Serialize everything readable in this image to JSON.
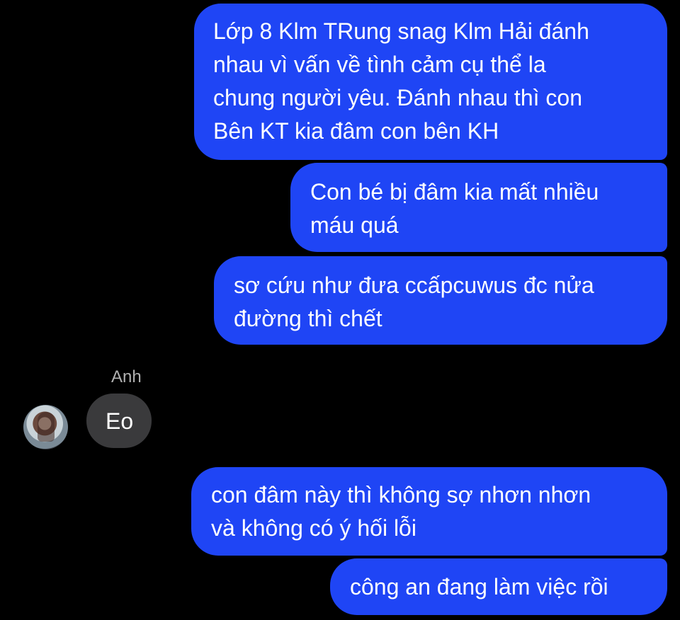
{
  "conversation": {
    "messages": [
      {
        "direction": "outgoing",
        "text": "Lớp 8 Klm TRung snag Klm Hải đánh\nnhau vì vấn về tình cảm cụ thể la\nchung người yêu. Đánh nhau thì con\nBên KT kia đâm con bên KH"
      },
      {
        "direction": "outgoing",
        "text": "Con bé bị đâm kia mất nhiều\nmáu quá"
      },
      {
        "direction": "outgoing",
        "text": "sơ cứu như đưa ccấpcuwus đc nửa\nđường thì chết"
      },
      {
        "direction": "incoming",
        "sender": "Anh",
        "text": "Eo"
      },
      {
        "direction": "outgoing",
        "text": "con đâm này thì không sợ nhơn nhơn\nvà không có ý hối lỗi"
      },
      {
        "direction": "outgoing",
        "text": "công an đang làm việc rồi"
      }
    ]
  },
  "colors": {
    "background": "#000000",
    "outgoing_bubble": "#1f45f5",
    "incoming_bubble": "#3a3a3c",
    "text": "#ffffff",
    "sender_name": "#b0b0b0"
  },
  "icons": {
    "avatar": "user-avatar-photo"
  }
}
